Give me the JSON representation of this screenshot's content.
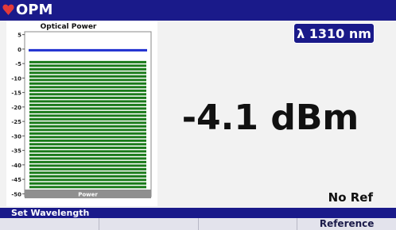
{
  "app": {
    "title": "OPM",
    "icon": "heart-shield-icon",
    "icon_color": "#e23a3a"
  },
  "colors": {
    "bar_accent": "#1a1a8a",
    "meter_fill": "#1a7a1a",
    "reference_line": "#1f2fd0"
  },
  "wavelength": {
    "label": "λ 1310 nm"
  },
  "reading": {
    "value": "-4.1 dBm"
  },
  "ref_status": "No Ref",
  "softkeys": {
    "header": "Set Wavelength",
    "keys": [
      "",
      "",
      "",
      "Reference"
    ]
  },
  "chart_data": {
    "type": "bar",
    "title": "Optical Power",
    "xlabel": "Power",
    "ylabel": "",
    "ylim": [
      -51,
      6
    ],
    "yticks": [
      "5",
      "0",
      "-5",
      "-10",
      "-15",
      "-20",
      "-25",
      "-30",
      "-35",
      "-40",
      "-45",
      "-50"
    ],
    "ytick_values": [
      5,
      0,
      -5,
      -10,
      -15,
      -20,
      -25,
      -30,
      -35,
      -40,
      -45,
      -50
    ],
    "categories": [
      "Power"
    ],
    "values": [
      -4.1
    ],
    "reference_line": -0.4
  }
}
